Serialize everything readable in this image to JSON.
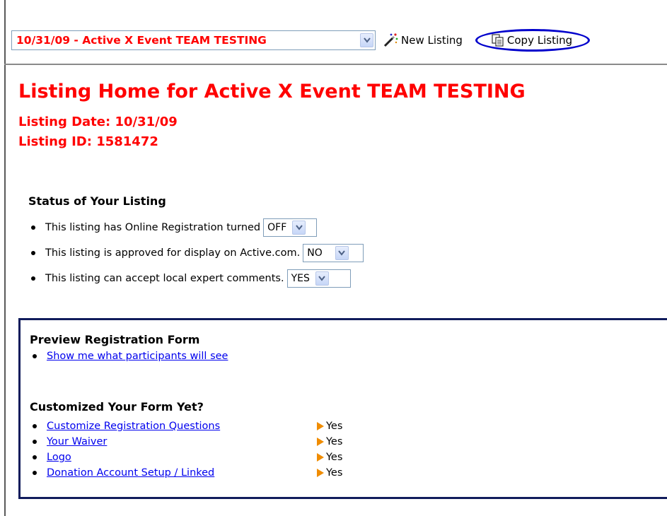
{
  "toolbar": {
    "listing_select_value": "10/31/09 - Active X Event TEAM TESTING",
    "new_listing_label": "New Listing",
    "copy_listing_label": "Copy Listing"
  },
  "header": {
    "title": "Listing Home for Active X Event TEAM TESTING",
    "listing_date": "Listing Date: 10/31/09",
    "listing_id": "Listing ID: 1581472"
  },
  "status": {
    "heading": "Status of Your Listing",
    "items": [
      {
        "text": "This listing has Online Registration turned",
        "value": "OFF"
      },
      {
        "text": "This listing is approved for display on Active.com.",
        "value": "NO"
      },
      {
        "text": "This listing can accept local expert comments.",
        "value": "YES"
      }
    ]
  },
  "preview": {
    "heading": "Preview Registration Form",
    "link": "Show me what participants will see"
  },
  "customize": {
    "heading": "Customized Your Form Yet?",
    "items": [
      {
        "label": "Customize Registration Questions",
        "status": "Yes"
      },
      {
        "label": "Your Waiver",
        "status": "Yes"
      },
      {
        "label": "Logo",
        "status": "Yes"
      },
      {
        "label": "Donation Account Setup / Linked",
        "status": "Yes"
      }
    ]
  },
  "colors": {
    "heading_red": "#ff0000",
    "link_blue": "#0000ee",
    "highlight_ellipse": "#0000cc",
    "box_border": "#101c5c",
    "status_arrow": "#f08c00"
  }
}
